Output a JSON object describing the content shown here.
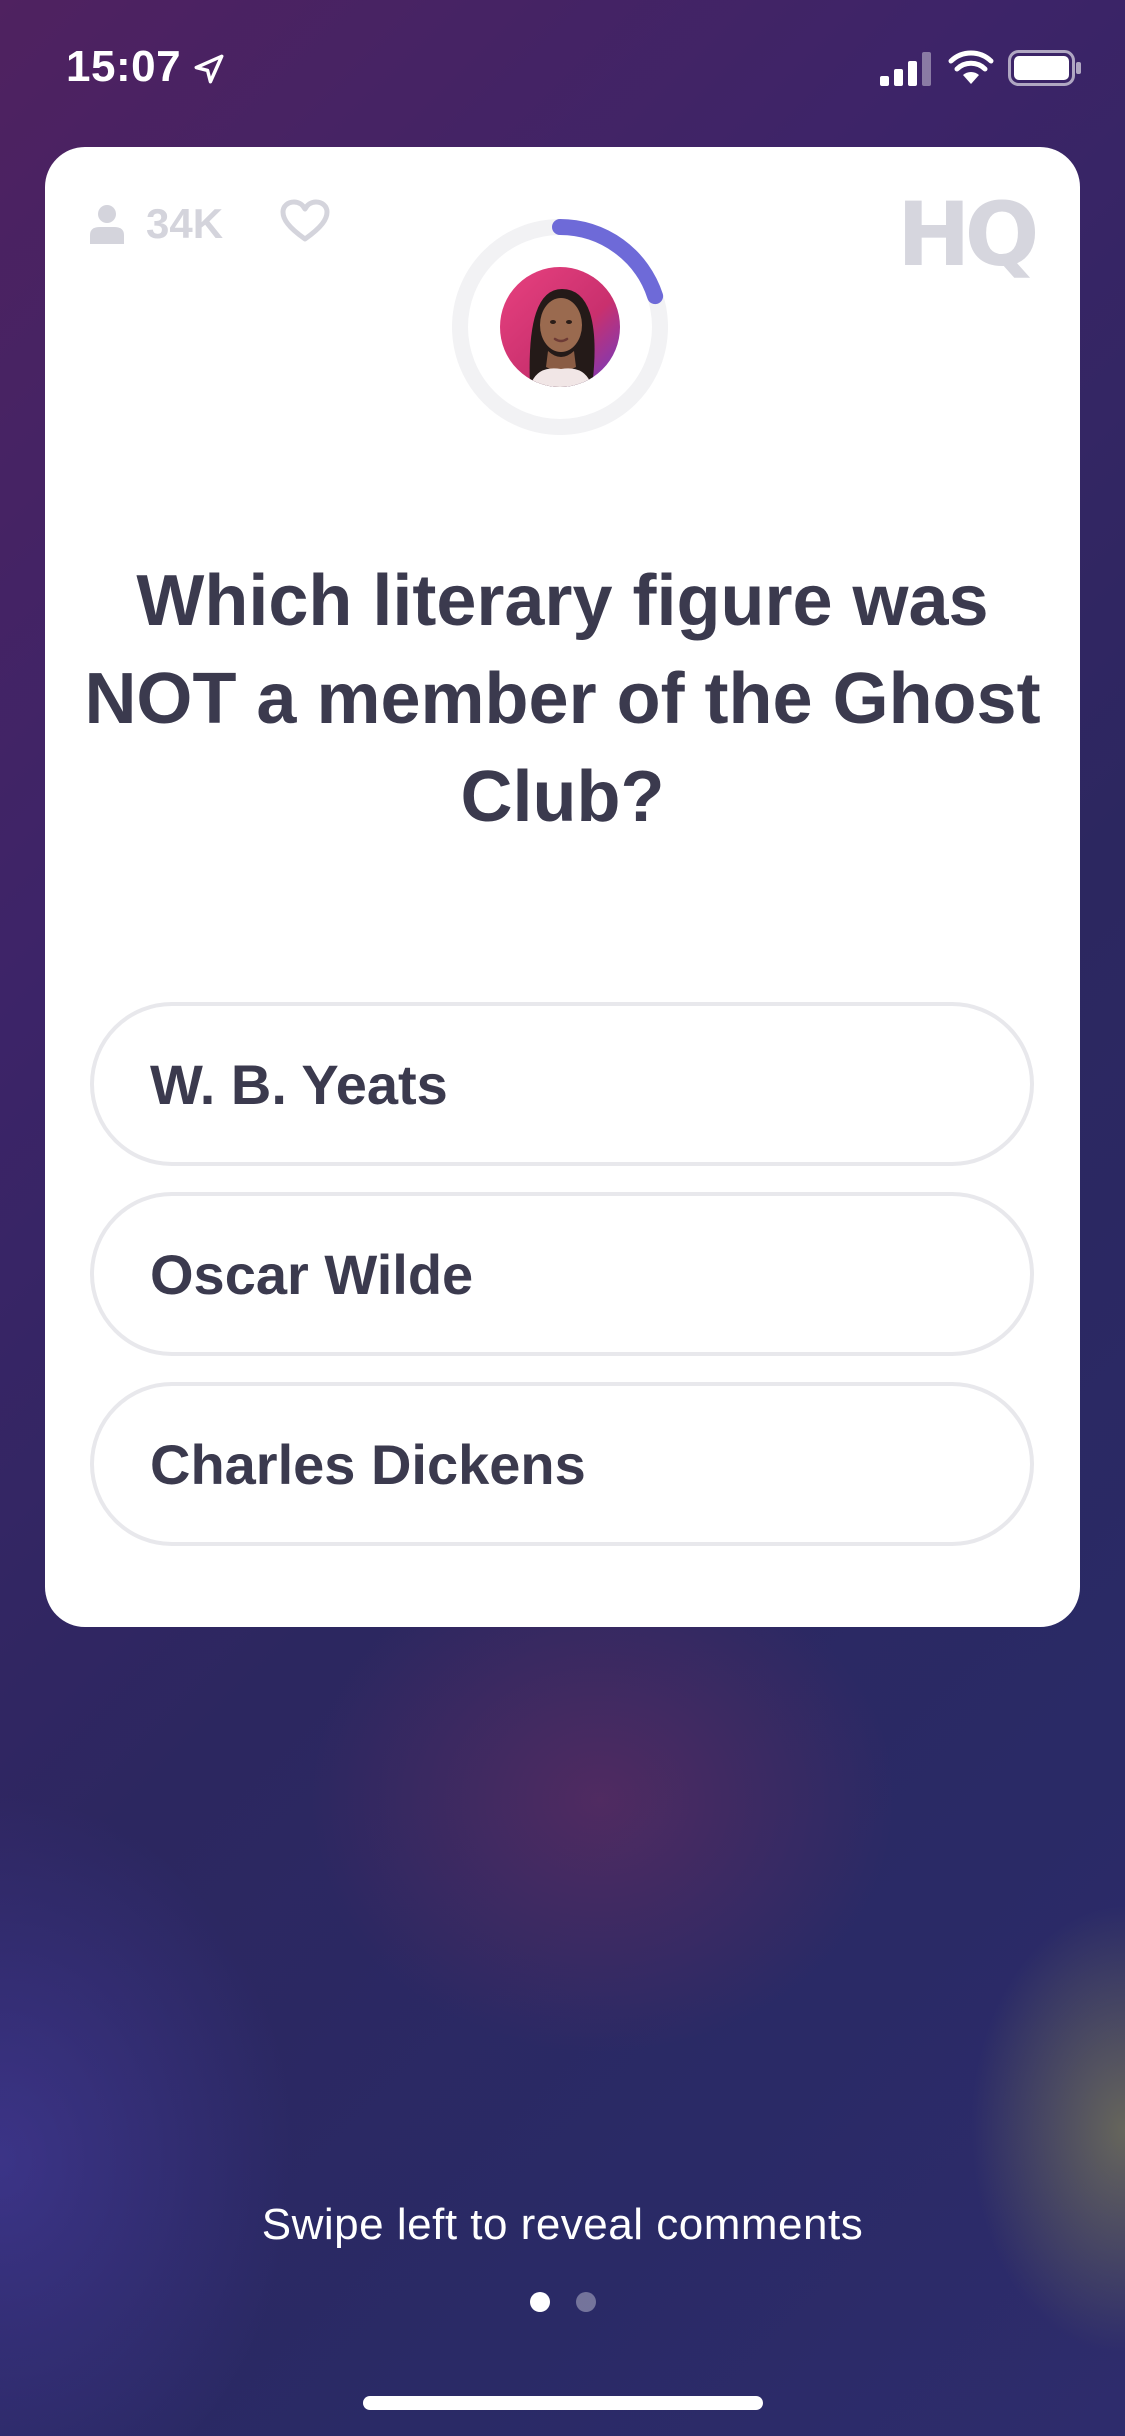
{
  "status_bar": {
    "time": "15:07",
    "icons": [
      "location-arrow-icon",
      "cellular-signal-icon",
      "wifi-icon",
      "battery-icon"
    ]
  },
  "card": {
    "viewer_count": "34K",
    "logo": "HQ",
    "host_avatar": "host-avatar",
    "question": "Which literary figure was NOT a member of the Ghost Club?",
    "answers": [
      {
        "label": "W. B. Yeats"
      },
      {
        "label": "Oscar Wilde"
      },
      {
        "label": "Charles Dickens"
      }
    ],
    "timer_progress": 0.2
  },
  "footer": {
    "swipe_hint": "Swipe left to reveal comments",
    "page_count": 2,
    "active_page": 1
  },
  "colors": {
    "accent_timer": "#6e6ad8",
    "text_dark": "#3b3a4e",
    "muted": "#d4d4dc",
    "avatar_bg": "#d8337a"
  }
}
